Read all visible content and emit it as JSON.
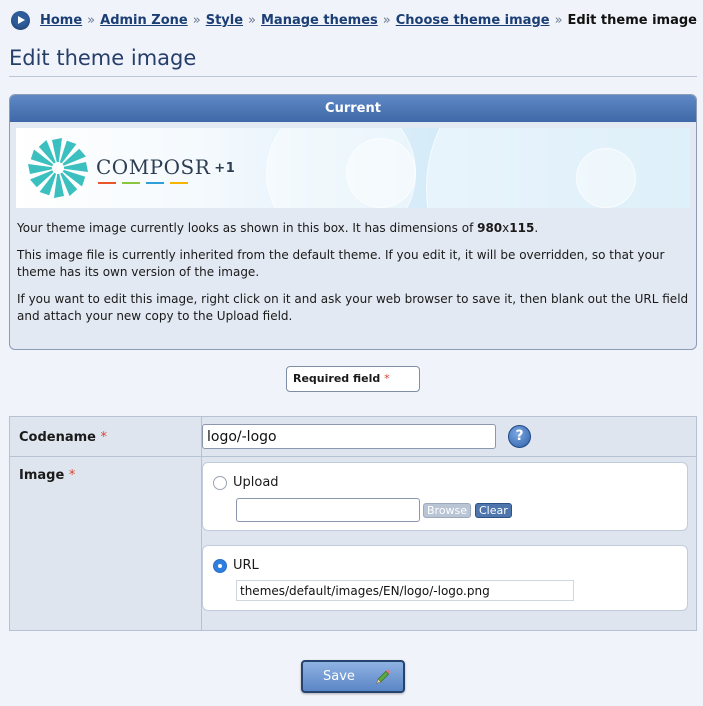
{
  "breadcrumb": {
    "items": [
      "Home",
      "Admin Zone",
      "Style",
      "Manage themes",
      "Choose theme image"
    ],
    "separator": "»",
    "current": "Edit theme image"
  },
  "page_title": "Edit theme image",
  "current_panel": {
    "heading": "Current",
    "logo_text": "COMPOSR",
    "logo_suffix": "+1",
    "dimensions_intro": "Your theme image currently looks as shown in this box. It has dimensions of ",
    "dimensions_width": "980",
    "dimensions_sep": "x",
    "dimensions_height": "115",
    "dimensions_end": ".",
    "inherit_note": "This image file is currently inherited from the default theme. If you edit it, it will be overridden, so that your theme has its own version of the image.",
    "edit_note": "If you want to edit this image, right click on it and ask your web browser to save it, then blank out the URL field and attach your new copy to the Upload field."
  },
  "required_legend": {
    "label": "Required field",
    "marker": "*"
  },
  "form": {
    "codename": {
      "label": "Codename",
      "marker": "*",
      "value": "logo/-logo",
      "help": "?"
    },
    "image": {
      "label": "Image",
      "marker": "*",
      "upload": {
        "label": "Upload",
        "selected": false,
        "browse_label": "Browse",
        "clear_label": "Clear"
      },
      "url": {
        "label": "URL",
        "selected": true,
        "value": "themes/default/images/EN/logo/-logo.png"
      }
    }
  },
  "save_label": "Save",
  "colors": {
    "accent": "#3f68a8",
    "link": "#1b3e75",
    "required": "#d9442f",
    "radio_selected": "#2f7fe0",
    "logo_teal": "#3bbfbf"
  },
  "icons": [
    "breadcrumb-arrow-icon",
    "help-icon",
    "pencil-icon"
  ]
}
